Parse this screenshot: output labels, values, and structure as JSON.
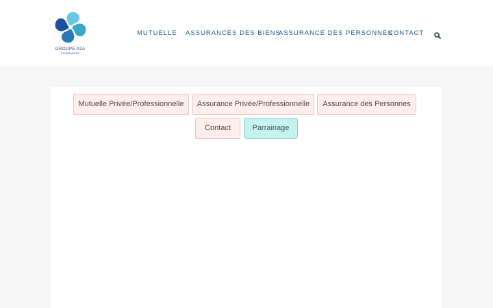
{
  "logo": {
    "title": "GROUPE A3A",
    "subtitle": "ASSURANCES"
  },
  "nav": {
    "items": [
      {
        "label": "MUTUELLE"
      },
      {
        "label": "ASSURANCES DES BIENS"
      },
      {
        "label": "ASSURANCE DES PERSONNES"
      },
      {
        "label": "CONTACT"
      }
    ],
    "search_icon": "search-icon"
  },
  "tabs": [
    {
      "label": "Mutuelle Privée/Professionnelle",
      "active": false
    },
    {
      "label": "Assurance Privée/Professionnelle",
      "active": false
    },
    {
      "label": "Assurance des Personnes",
      "active": false
    },
    {
      "label": "Contact",
      "active": false
    },
    {
      "label": "Parrainage",
      "active": true
    }
  ],
  "colors": {
    "nav_text": "#1d5a8a",
    "tab_bg": "#fceeec",
    "tab_border": "#f0c4bd",
    "tab_active_bg": "#c6f2ee",
    "tab_active_border": "#86d8d6",
    "page_bg": "#f6f6f6"
  }
}
